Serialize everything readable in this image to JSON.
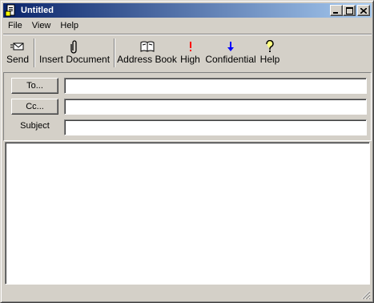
{
  "window": {
    "title": "Untitled"
  },
  "menu": {
    "items": [
      "File",
      "View",
      "Help"
    ]
  },
  "toolbar": {
    "send": "Send",
    "insert_document": "Insert Document",
    "address_book": "Address Book",
    "high": "High",
    "confidential": "Confidential",
    "help": "Help"
  },
  "fields": {
    "to_button": "To...",
    "cc_button": "Cc...",
    "subject_label": "Subject",
    "to_value": "",
    "cc_value": "",
    "subject_value": ""
  },
  "message": {
    "body": ""
  },
  "icons": {
    "app": "document-icon",
    "send": "send-icon",
    "insert_document": "paperclip-icon",
    "address_book": "book-icon",
    "high": "exclamation-icon",
    "confidential": "down-arrow-icon",
    "help": "question-icon"
  },
  "colors": {
    "titlebar_start": "#0a246a",
    "titlebar_end": "#a6caf0",
    "face": "#d4d0c8",
    "high_priority": "#ff0000",
    "confidential": "#0000ff"
  }
}
